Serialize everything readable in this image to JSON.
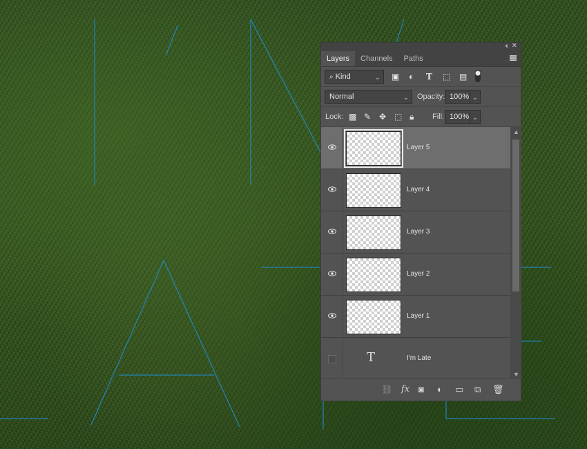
{
  "panel": {
    "tabs": [
      "Layers",
      "Channels",
      "Paths"
    ],
    "active_tab": "Layers",
    "filter": {
      "value": "Kind",
      "icons": [
        "image-filter-icon",
        "adjustment-filter-icon",
        "type-filter-icon",
        "shape-filter-icon",
        "smart-object-filter-icon",
        "filter-toggle-icon"
      ]
    },
    "blend_mode": "Normal",
    "opacity_label": "Opacity:",
    "opacity_value": "100%",
    "lock_label": "Lock:",
    "lock_icons": [
      "lock-transparent-pixels-icon",
      "lock-image-pixels-icon",
      "lock-position-icon",
      "lock-artboard-icon",
      "lock-all-icon"
    ],
    "fill_label": "Fill:",
    "fill_value": "100%",
    "layers": [
      {
        "name": "Layer 5",
        "visible": true,
        "selected": true,
        "kind": "pixel"
      },
      {
        "name": "Layer 4",
        "visible": true,
        "selected": false,
        "kind": "pixel"
      },
      {
        "name": "Layer 3",
        "visible": true,
        "selected": false,
        "kind": "pixel"
      },
      {
        "name": "Layer 2",
        "visible": true,
        "selected": false,
        "kind": "pixel"
      },
      {
        "name": "Layer 1",
        "visible": true,
        "selected": false,
        "kind": "pixel"
      },
      {
        "name": "I'm Late",
        "visible": false,
        "selected": false,
        "kind": "type"
      }
    ],
    "bottom_icons": [
      "link-layers-icon",
      "fx-icon",
      "add-mask-icon",
      "adjustment-layer-icon",
      "new-group-icon",
      "new-layer-icon",
      "delete-icon"
    ]
  },
  "colors": {
    "panel_bg": "#535353",
    "guide_line": "#1e8fd6",
    "selected_row": "#6e6e6e"
  }
}
